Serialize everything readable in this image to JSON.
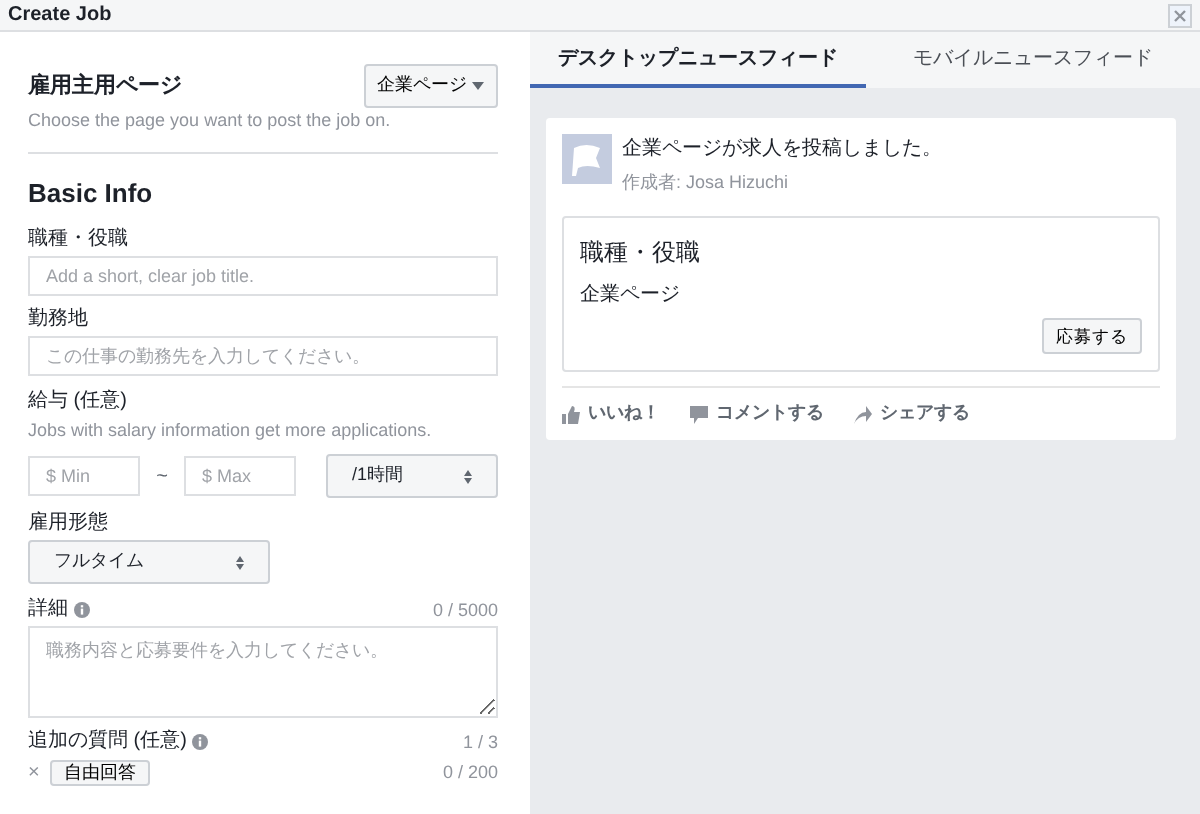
{
  "window": {
    "title": "Create Job"
  },
  "form": {
    "page_section": {
      "title": "雇用主用ページ",
      "hint": "Choose the page you want to post the job on.",
      "page_button": "企業ページ"
    },
    "heading": "Basic Info",
    "job_title": {
      "label": "職種・役職",
      "placeholder": "Add a short, clear job title."
    },
    "location": {
      "label": "勤務地",
      "placeholder": "この仕事の勤務先を入力してください。"
    },
    "salary": {
      "label": "給与 (任意)",
      "hint": "Jobs with salary information get more applications.",
      "min_placeholder": "$ Min",
      "separator": "~",
      "max_placeholder": "$ Max",
      "period": "/1時間"
    },
    "employment_type": {
      "label": "雇用形態",
      "value": "フルタイム"
    },
    "details": {
      "label": "詳細",
      "counter": "0 / 5000",
      "placeholder": "職務内容と応募要件を入力してください。"
    },
    "questions": {
      "label": "追加の質問 (任意)",
      "counter": "1 / 3",
      "remove": "×",
      "type": "自由回答",
      "type_counter": "0 / 200"
    }
  },
  "preview": {
    "tabs": [
      {
        "label": "デスクトップニュースフィード",
        "selected": true
      },
      {
        "label": "モバイルニュースフィード",
        "selected": false
      }
    ],
    "post": {
      "headline": "企業ページが求人を投稿しました。",
      "author": "作成者: Josa Hizuchi",
      "job_title": "職種・役職",
      "company": "企業ページ",
      "apply_button": "応募する",
      "actions": [
        "いいね！",
        "コメントする",
        "シェアする"
      ]
    }
  }
}
